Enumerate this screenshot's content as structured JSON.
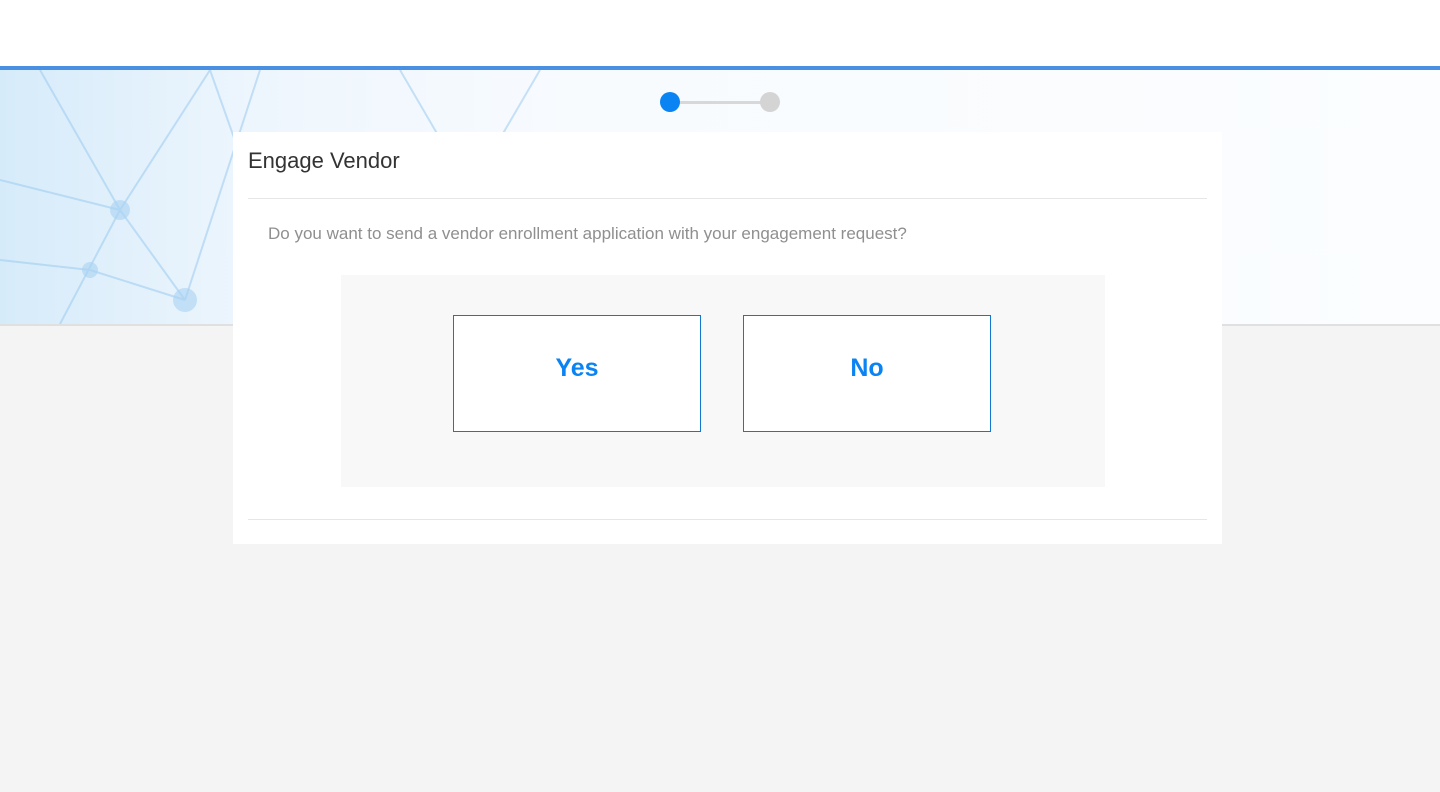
{
  "header": {
    "accent_color": "#4a90e2"
  },
  "stepper": {
    "current_step": 1,
    "total_steps": 2,
    "active_color": "#0a84f2",
    "inactive_color": "#d4d4d4"
  },
  "card": {
    "title": "Engage Vendor",
    "question": "Do you want to send a vendor enrollment application with your engagement request?",
    "options": {
      "yes_label": "Yes",
      "no_label": "No"
    },
    "button_color": "#0a84f2"
  }
}
